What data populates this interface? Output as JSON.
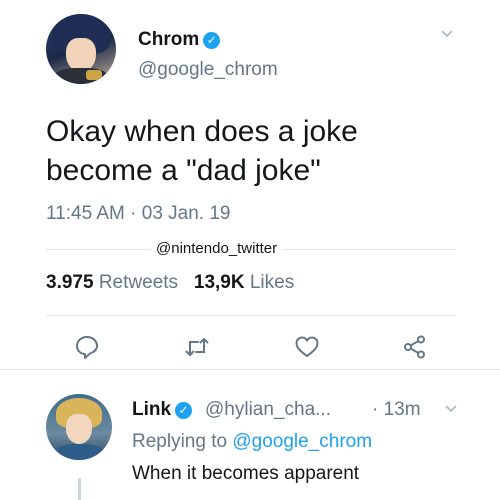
{
  "tweet": {
    "display_name": "Chrom",
    "handle": "@google_chrom",
    "text_line1": "Okay when does a joke",
    "text_line2": "become a \"dad joke\"",
    "timestamp": "11:45 AM · 03 Jan. 19",
    "watermark": "@nintendo_twitter",
    "retweets_count": "3.975",
    "retweets_label": "Retweets",
    "likes_count": "13,9K",
    "likes_label": "Likes",
    "avatar_icon": "chrom-avatar",
    "verified_icon": "verified-badge-icon"
  },
  "actions": [
    {
      "name": "reply",
      "icon": "reply-icon"
    },
    {
      "name": "retweet",
      "icon": "retweet-icon"
    },
    {
      "name": "like",
      "icon": "heart-icon"
    },
    {
      "name": "share",
      "icon": "share-icon"
    }
  ],
  "reply": {
    "display_name": "Link",
    "handle": "@hylian_cha...",
    "time": "· 13m",
    "replying_prefix": "Replying to",
    "replying_to": "@google_chrom",
    "text": "When it becomes apparent",
    "avatar_icon": "link-avatar"
  },
  "colors": {
    "accent": "#1da1f2",
    "text_primary": "#14171a",
    "text_secondary": "#657786",
    "divider": "#e1e8ed"
  }
}
